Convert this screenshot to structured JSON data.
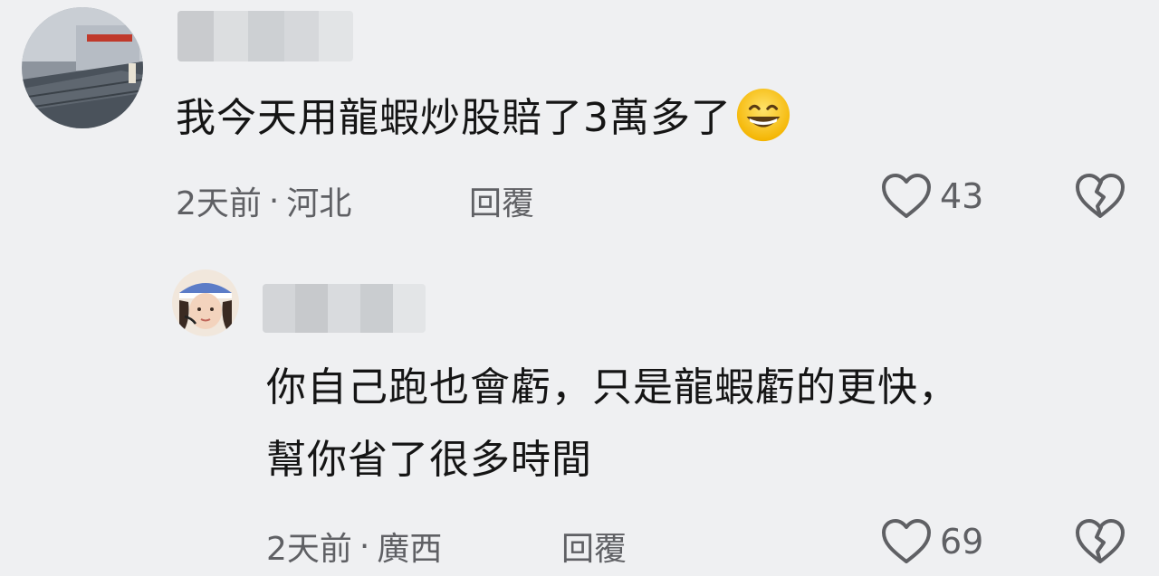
{
  "comments": [
    {
      "text": "我今天用龍蝦炒股賠了3萬多了",
      "emoji": "grinning-face-icon",
      "time": "2天前",
      "separator": "·",
      "location": "河北",
      "reply_label": "回覆",
      "like_count": "43"
    },
    {
      "text_line1": "你自己跑也會虧，只是龍蝦虧的更快，",
      "text_line2": "幫你省了很多時間",
      "time": "2天前",
      "separator": "·",
      "location": "廣西",
      "reply_label": "回覆",
      "like_count": "69"
    }
  ],
  "colors": {
    "background": "#eff0f2",
    "text": "#151515",
    "meta_text": "#5f6064",
    "icon_stroke": "#5f6064"
  }
}
